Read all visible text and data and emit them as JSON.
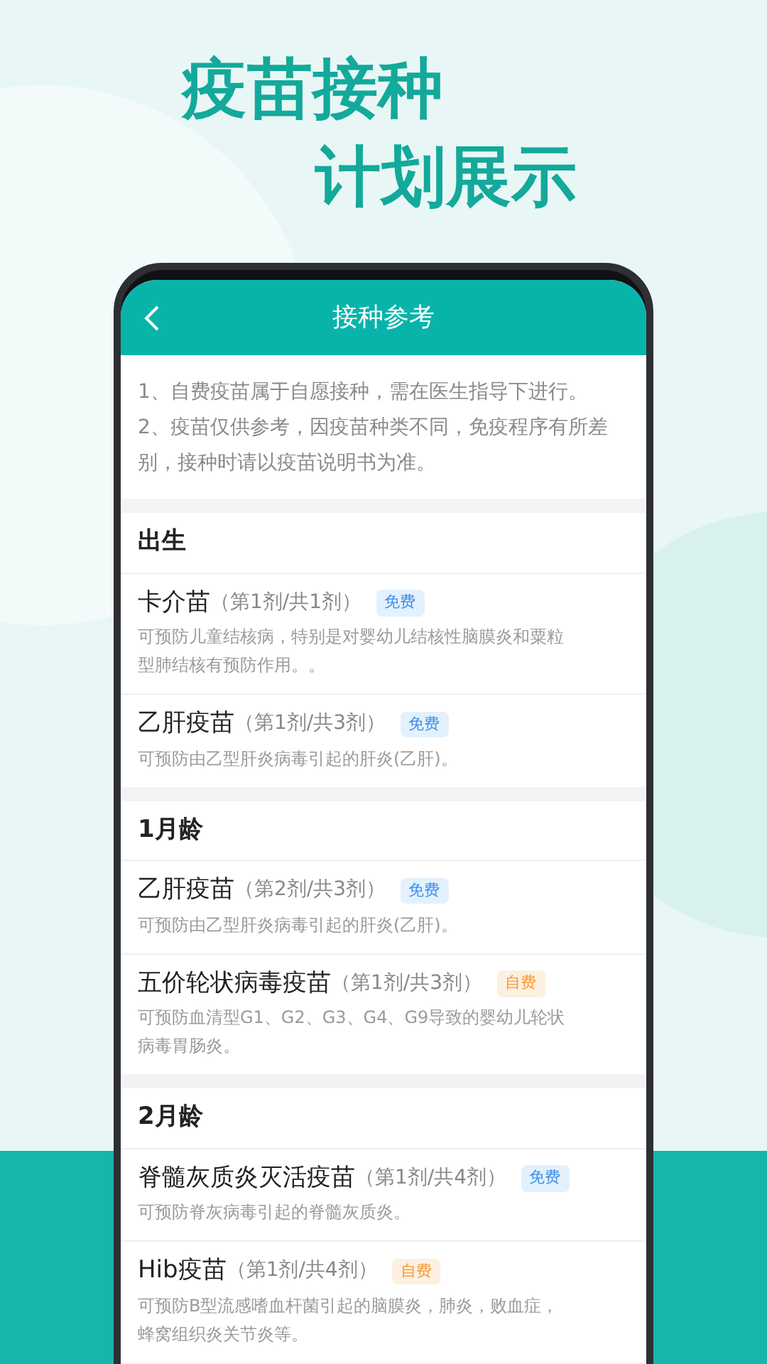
{
  "headline": [
    "疫苗接种",
    "计划展示"
  ],
  "header": {
    "title": "接种参考"
  },
  "notice": [
    "1、自费疫苗属于自愿接种，需在医生指导下进行。",
    "2、疫苗仅供参考，因疫苗种类不同，免疫程序有所差别，接种时请以疫苗说明书为准。"
  ],
  "sections": [
    {
      "title": "出生",
      "vaccines": [
        {
          "name": "卡介苗",
          "dose": "（第1剂/共1剂）",
          "fee": {
            "kind": "free",
            "label": "免费"
          },
          "description": "可预防儿童结核病，特别是对婴幼儿结核性脑膜炎和粟粒型肺结核有预防作用。。"
        },
        {
          "name": "乙肝疫苗",
          "dose": "（第1剂/共3剂）",
          "fee": {
            "kind": "free",
            "label": "免费"
          },
          "description": "可预防由乙型肝炎病毒引起的肝炎(乙肝)。"
        }
      ]
    },
    {
      "title": "1月龄",
      "vaccines": [
        {
          "name": "乙肝疫苗",
          "dose": "（第2剂/共3剂）",
          "fee": {
            "kind": "free",
            "label": "免费"
          },
          "description": "可预防由乙型肝炎病毒引起的肝炎(乙肝)。"
        },
        {
          "name": "五价轮状病毒疫苗",
          "dose": "（第1剂/共3剂）",
          "fee": {
            "kind": "paid",
            "label": "自费"
          },
          "description": "可预防血清型G1、G2、G3、G4、G9导致的婴幼儿轮状病毒胃肠炎。"
        }
      ]
    },
    {
      "title": "2月龄",
      "vaccines": [
        {
          "name": "脊髓灰质炎灭活疫苗",
          "dose": "（第1剂/共4剂）",
          "fee": {
            "kind": "free",
            "label": "免费"
          },
          "description": "可预防脊灰病毒引起的脊髓灰质炎。"
        },
        {
          "name": "Hib疫苗",
          "dose": "（第1剂/共4剂）",
          "fee": {
            "kind": "paid",
            "label": "自费"
          },
          "description": "可预防B型流感嗜血杆菌引起的脑膜炎，肺炎，败血症，蜂窝组织炎关节炎等。"
        }
      ]
    }
  ]
}
